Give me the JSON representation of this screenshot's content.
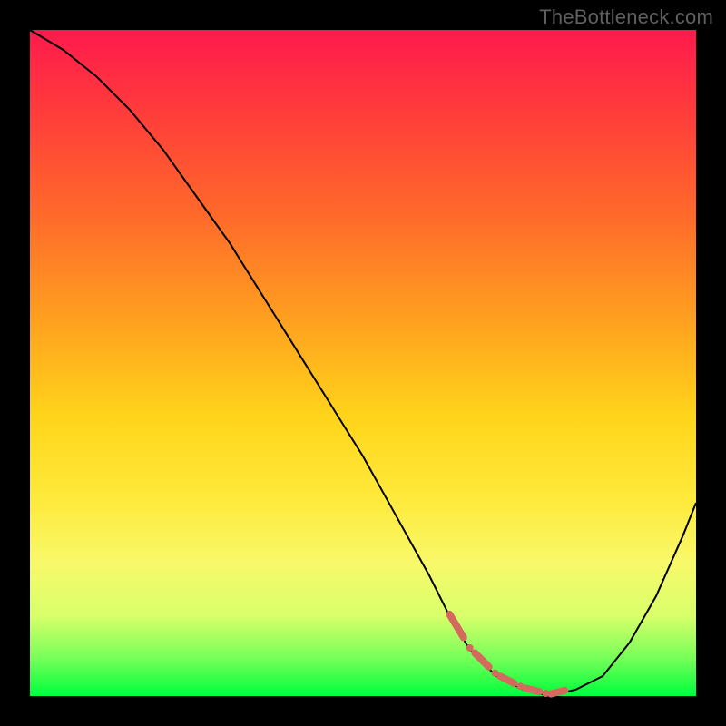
{
  "watermark": "TheBottleneck.com",
  "colors": {
    "frame": "#000000",
    "curve": "#000000",
    "marker": "#d46a5e",
    "gradient_top": "#ff1a4d",
    "gradient_bottom": "#00ff3c"
  },
  "chart_data": {
    "type": "line",
    "title": "",
    "xlabel": "",
    "ylabel": "",
    "xlim": [
      0,
      100
    ],
    "ylim": [
      0,
      100
    ],
    "grid": false,
    "legend": false,
    "series": [
      {
        "name": "bottleneck_curve",
        "x": [
          0,
          5,
          10,
          15,
          20,
          25,
          30,
          35,
          40,
          45,
          50,
          55,
          60,
          63,
          66,
          70,
          74,
          78,
          82,
          86,
          90,
          94,
          98,
          100
        ],
        "y": [
          100,
          97,
          93,
          88,
          82,
          75,
          68,
          60,
          52,
          44,
          36,
          27,
          18,
          12,
          7,
          3,
          1,
          0,
          1,
          3,
          8,
          15,
          24,
          29
        ]
      }
    ],
    "annotations": [
      {
        "name": "optimal_range_marker",
        "x_start": 63,
        "x_end": 82,
        "style": "dashed",
        "color": "#d46a5e"
      }
    ]
  }
}
